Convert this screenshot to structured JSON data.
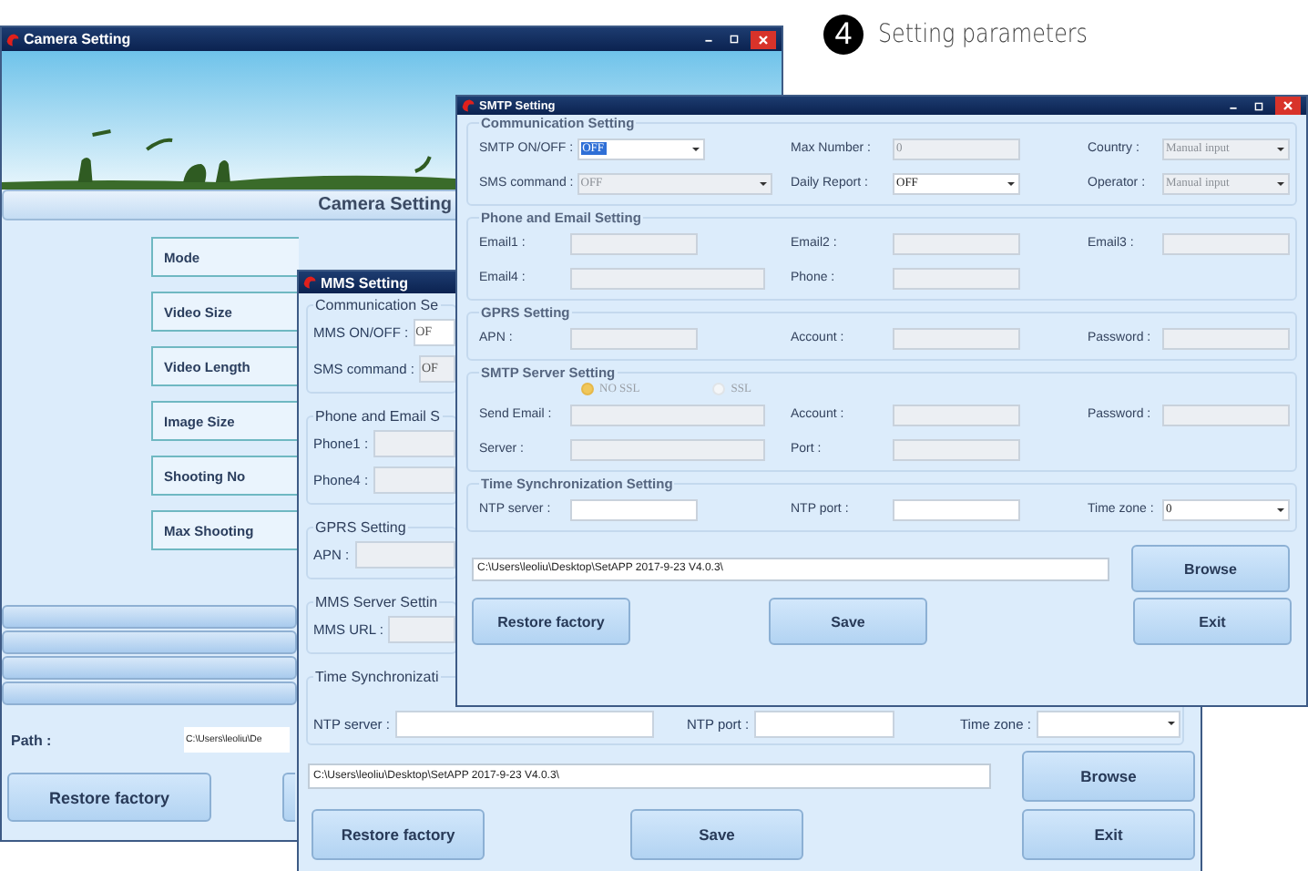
{
  "step": {
    "number": "4",
    "title": "Setting parameters"
  },
  "camera_window": {
    "title": "Camera Setting",
    "header": "Camera Setting",
    "settings": [
      "Mode",
      "Video Size",
      "Video Length",
      "Image Size",
      "Shooting No",
      "Max Shooting"
    ],
    "path_label": "Path :",
    "path": "C:\\Users\\leoliu\\De",
    "buttons": [
      "Restore factory"
    ]
  },
  "mms_window": {
    "title": "MMS Setting",
    "groups": [
      {
        "title": "Communication Se",
        "fields": [
          {
            "label": "MMS ON/OFF :",
            "value": "OF",
            "disabled": false
          },
          {
            "label": "SMS command :",
            "value": "OF",
            "disabled": true
          }
        ]
      },
      {
        "title": "Phone and Email S",
        "fields": [
          {
            "label": "Phone1 :",
            "disabled": true
          },
          {
            "label": "Phone4 :",
            "disabled": true
          }
        ]
      },
      {
        "title": "GPRS Setting",
        "fields": [
          {
            "label": "APN :",
            "disabled": true
          }
        ]
      },
      {
        "title": "MMS Server Settin",
        "fields": [
          {
            "label": "MMS URL :",
            "disabled": true
          }
        ]
      }
    ],
    "time_sync": {
      "title": "Time Synchronizati",
      "fields": [
        {
          "label": "NTP server :",
          "kind": "text",
          "disabled": false
        },
        {
          "label": "NTP port :",
          "kind": "text",
          "disabled": false
        },
        {
          "label": "Time zone :",
          "kind": "select",
          "disabled": false
        }
      ]
    },
    "path": "C:\\Users\\leoliu\\Desktop\\SetAPP 2017-9-23 V4.0.3\\",
    "browse": "Browse",
    "buttons": [
      "Restore factory",
      "Save",
      "Exit"
    ]
  },
  "smtp_window": {
    "title": "SMTP Setting",
    "groups": [
      {
        "title": "Communication Setting",
        "rows": [
          [
            {
              "label": "SMTP ON/OFF :",
              "kind": "select",
              "value": "OFF",
              "disabled": false,
              "highlighted": true
            },
            {
              "label": "Max Number :",
              "kind": "text",
              "value": "0",
              "disabled": true,
              "highlighted": false
            },
            {
              "label": "Country :",
              "kind": "select",
              "value": "Manual input",
              "disabled": true,
              "highlighted": false
            }
          ],
          [
            {
              "label": "SMS command :",
              "kind": "select",
              "value": "OFF",
              "disabled": true,
              "highlighted": false
            },
            {
              "label": "Daily Report :",
              "kind": "select",
              "value": "OFF",
              "disabled": false,
              "highlighted": false
            },
            {
              "label": "Operator :",
              "kind": "select",
              "value": "Manual input",
              "disabled": true,
              "highlighted": false
            }
          ]
        ]
      },
      {
        "title": "Phone and Email Setting",
        "rows": [
          [
            {
              "label": "Email1 :",
              "kind": "text",
              "disabled": true
            },
            {
              "label": "Email2 :",
              "kind": "text",
              "disabled": true
            },
            {
              "label": "Email3 :",
              "kind": "text",
              "disabled": true
            }
          ],
          [
            {
              "label": "Email4 :",
              "kind": "text",
              "disabled": true
            },
            {
              "label": "Phone :",
              "kind": "text",
              "disabled": true
            }
          ]
        ]
      },
      {
        "title": "GPRS Setting",
        "rows": [
          [
            {
              "label": "APN :",
              "kind": "text",
              "disabled": true
            },
            {
              "label": "Account :",
              "kind": "text",
              "disabled": true
            },
            {
              "label": "Password :",
              "kind": "text",
              "disabled": true
            }
          ]
        ]
      },
      {
        "title": "SMTP Server Setting",
        "options": [
          {
            "label": "NO SSL",
            "selected": true
          },
          {
            "label": "SSL",
            "selected": false
          }
        ],
        "rows": [
          [
            {
              "label": "Send Email :",
              "kind": "text",
              "disabled": true
            },
            {
              "label": "Account :",
              "kind": "text",
              "disabled": true
            },
            {
              "label": "Password :",
              "kind": "text",
              "disabled": true
            }
          ],
          [
            {
              "label": "Server :",
              "kind": "text",
              "disabled": true
            },
            {
              "label": "Port :",
              "kind": "text",
              "disabled": true
            }
          ]
        ]
      },
      {
        "title": "Time Synchronization  Setting",
        "rows": [
          [
            {
              "label": "NTP server :",
              "kind": "text",
              "disabled": false
            },
            {
              "label": "NTP port :",
              "kind": "text",
              "disabled": false
            },
            {
              "label": "Time zone :",
              "kind": "select",
              "value": "0",
              "disabled": false,
              "highlighted": false
            }
          ]
        ]
      }
    ],
    "path": "C:\\Users\\leoliu\\Desktop\\SetAPP 2017-9-23 V4.0.3\\",
    "browse": "Browse",
    "buttons": [
      "Restore factory",
      "Save",
      "Exit"
    ]
  }
}
